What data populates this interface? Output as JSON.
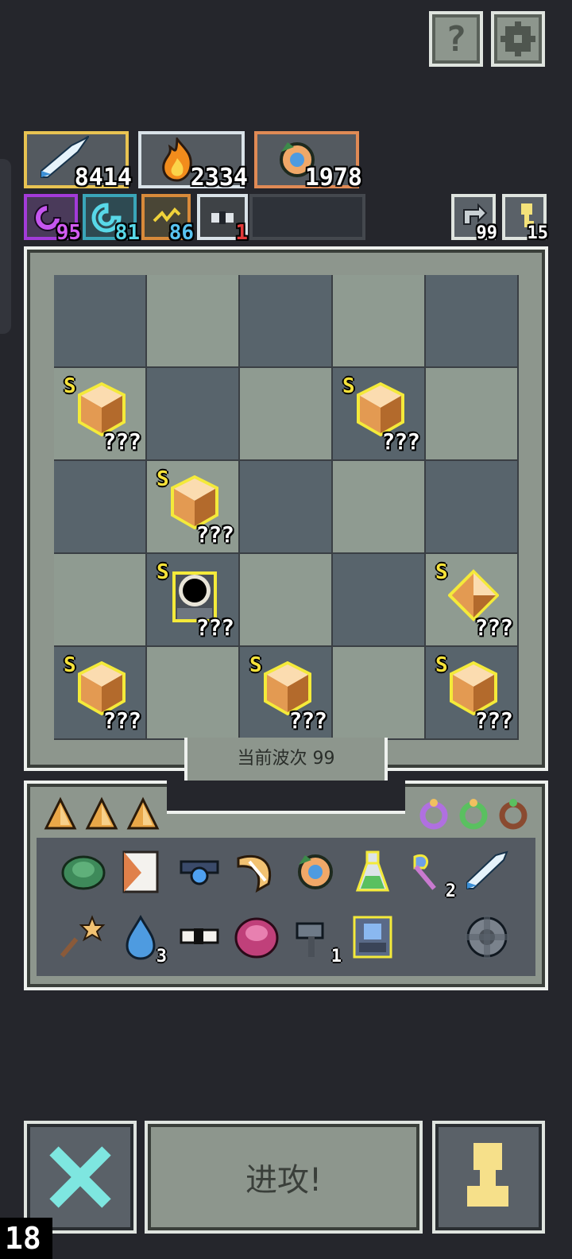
{
  "top_buttons": {
    "help_label": "?",
    "settings_icon": "gear-icon"
  },
  "stats": [
    {
      "icon": "sword-icon",
      "value": "8414",
      "border": "#e8c352"
    },
    {
      "icon": "fire-icon",
      "value": "2334",
      "border": "#d9e2e8"
    },
    {
      "icon": "orb-icon",
      "value": "1978",
      "border": "#e08a55"
    }
  ],
  "effects": [
    {
      "icon": "purple-spiral-icon",
      "value": "95",
      "border": "#a33bd9",
      "color": "#d35cf2"
    },
    {
      "icon": "cyan-spiral-icon",
      "value": "81",
      "border": "#3aa5b8",
      "color": "#58d8e8"
    },
    {
      "icon": "lightning-icon",
      "value": "86",
      "border": "#d88a3a",
      "color": "#59c3f0"
    },
    {
      "icon": "eye-icon",
      "value": "1",
      "border": "#d9e2e8",
      "color": "#e23a3a"
    }
  ],
  "counters": {
    "recycle": "99",
    "ticket": "15"
  },
  "grid": {
    "rows": 5,
    "cols": 5,
    "items": [
      {
        "row": 1,
        "col": 0,
        "rank": "S",
        "label": "???",
        "kind": "gem"
      },
      {
        "row": 1,
        "col": 3,
        "rank": "S",
        "label": "???",
        "kind": "gem"
      },
      {
        "row": 2,
        "col": 1,
        "rank": "S",
        "label": "???",
        "kind": "gem"
      },
      {
        "row": 3,
        "col": 1,
        "rank": "S",
        "label": "???",
        "kind": "portal"
      },
      {
        "row": 3,
        "col": 4,
        "rank": "S",
        "label": "???",
        "kind": "diamond"
      },
      {
        "row": 4,
        "col": 0,
        "rank": "S",
        "label": "???",
        "kind": "gem"
      },
      {
        "row": 4,
        "col": 2,
        "rank": "S",
        "label": "???",
        "kind": "gem"
      },
      {
        "row": 4,
        "col": 4,
        "rank": "S",
        "label": "???",
        "kind": "gem"
      }
    ]
  },
  "wave": {
    "label": "当前波次 99"
  },
  "inventory": {
    "shards": [
      "shard-icon",
      "shard-icon",
      "shard-icon"
    ],
    "rings": [
      "purple-ring-icon",
      "green-ring-icon",
      "brown-ring-icon"
    ],
    "row1": [
      {
        "name": "turtle-shell-icon",
        "count": ""
      },
      {
        "name": "scroll-icon",
        "count": ""
      },
      {
        "name": "amulet-icon",
        "count": ""
      },
      {
        "name": "horn-icon",
        "count": ""
      },
      {
        "name": "orb-icon",
        "count": ""
      },
      {
        "name": "potion-icon",
        "count": ""
      },
      {
        "name": "axe-icon",
        "count": "2"
      },
      {
        "name": "blade-icon",
        "count": ""
      }
    ],
    "row2": [
      {
        "name": "star-wand-icon",
        "count": ""
      },
      {
        "name": "water-drop-icon",
        "count": "3"
      },
      {
        "name": "eye-rune-icon",
        "count": ""
      },
      {
        "name": "pink-slime-icon",
        "count": ""
      },
      {
        "name": "hammer-icon",
        "count": "1"
      },
      {
        "name": "armor-icon",
        "count": ""
      },
      {
        "name": "cog-icon",
        "count": ""
      }
    ]
  },
  "bottom": {
    "attack_label": "进攻!",
    "level": "18"
  }
}
